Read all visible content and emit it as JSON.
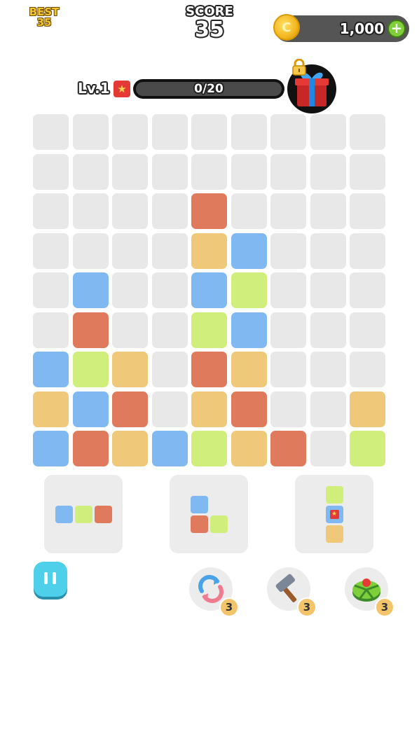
{
  "header": {
    "best_label": "BEST",
    "best_value": "35",
    "score_label": "SCORE",
    "score_value": "35",
    "coin_amount": "1,000",
    "coin_symbol": "C",
    "coin_plus": "+"
  },
  "level": {
    "label": "Lv.1",
    "progress_text": "0/20",
    "progress_fraction": 0.0
  },
  "colors": {
    "empty": "#e8e8e8",
    "R": "#e07a5c",
    "B": "#80b9f2",
    "Y": "#f0c879",
    "G": "#cfee7c"
  },
  "board": {
    "rows": [
      ".........",
      ".........",
      "....R....",
      "....YB...",
      ".B..BG...",
      ".R..GB...",
      "BGY.RY...",
      "YBR.YR..Y",
      "BRYBGYR.G"
    ]
  },
  "tray": [
    {
      "cells": [
        [
          "B",
          "G",
          "R"
        ]
      ]
    },
    {
      "cells": [
        [
          "B",
          "."
        ],
        [
          "R",
          "G"
        ]
      ]
    },
    {
      "cells": [
        [
          "G"
        ],
        [
          "B*"
        ],
        [
          "Y"
        ]
      ]
    }
  ],
  "tools": [
    {
      "icon": "shuffle-icon",
      "count": "3"
    },
    {
      "icon": "hammer-icon",
      "count": "3"
    },
    {
      "icon": "bomb-icon",
      "count": "3"
    }
  ]
}
